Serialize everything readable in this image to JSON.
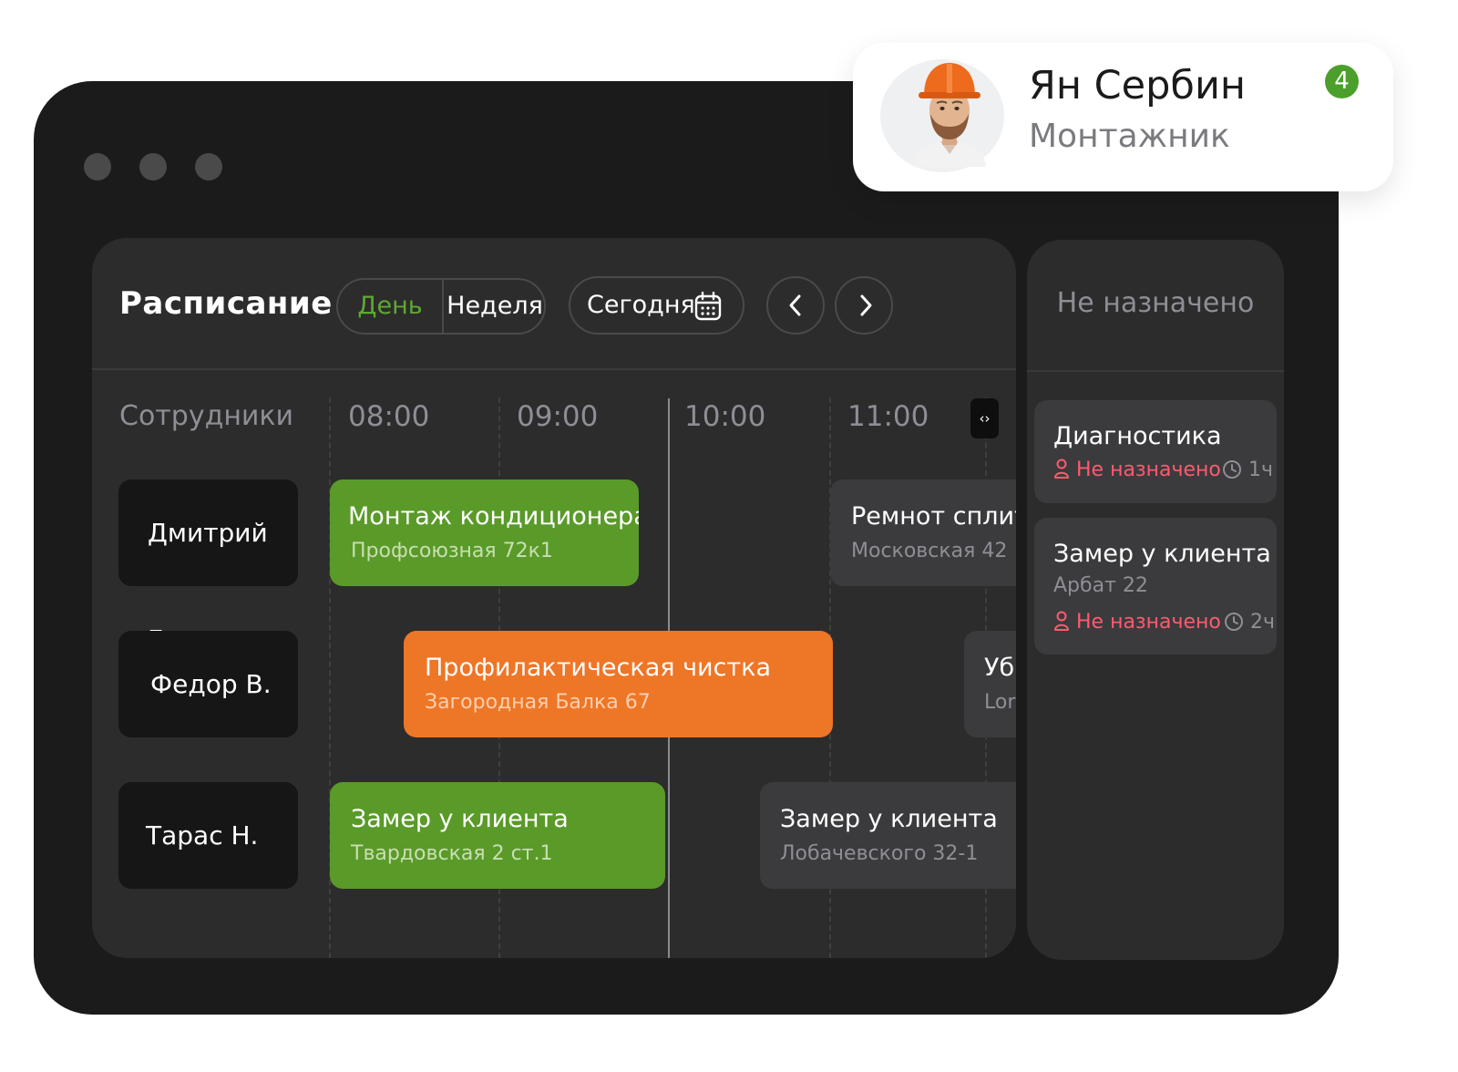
{
  "colors": {
    "accent_green": "#5a9a29",
    "accent_orange": "#ee7627",
    "unassigned_red": "#ff5a6e",
    "badge_green": "#4b9f2a"
  },
  "window": {
    "controls": [
      "window-dot",
      "window-dot",
      "window-dot"
    ]
  },
  "schedule": {
    "title": "Расписание",
    "view_toggle": {
      "day": "День",
      "week": "Неделя",
      "selected": "День"
    },
    "today_label": "Сегодня",
    "today_icon": "calendar-icon",
    "nav_prev_icon": "chevron-left-icon",
    "nav_next_icon": "chevron-right-icon",
    "employees_header": "Сотрудники",
    "times": [
      "08:00",
      "09:00",
      "10:00",
      "11:00"
    ],
    "expand_icon": "code-icon",
    "expand_label": "‹›",
    "employees": [
      "Дмитрий Г.",
      "Федор В.",
      "Тарас Н."
    ],
    "tasks": [
      {
        "title": "Монтаж кондиционера",
        "address": "Профсоюзная 72к1",
        "status": "green"
      },
      {
        "title": "Ремнот сплит",
        "address": "Московская 42",
        "status": "gray"
      },
      {
        "title": "Профилактическая чистка",
        "address": "Загородная Балка 67",
        "status": "orange"
      },
      {
        "title": "Уб",
        "address": "Lor",
        "status": "gray"
      },
      {
        "title": "Замер у клиента",
        "address": "Твардовская 2 ст.1",
        "status": "green"
      },
      {
        "title": "Замер у клиента",
        "address": "Лобачевского 32-1",
        "status": "gray"
      }
    ]
  },
  "unassigned": {
    "title": "Не назначено",
    "items": [
      {
        "title": "Диагностика",
        "address": "",
        "status": "Не назначено",
        "duration": "1ч"
      },
      {
        "title": "Замер у клиента",
        "address": "Арбат 22",
        "status": "Не назначено",
        "duration": "2ч"
      }
    ]
  },
  "profile": {
    "name": "Ян Сербин",
    "role": "Монтажник",
    "badge_count": "4",
    "avatar": "worker-avatar"
  }
}
